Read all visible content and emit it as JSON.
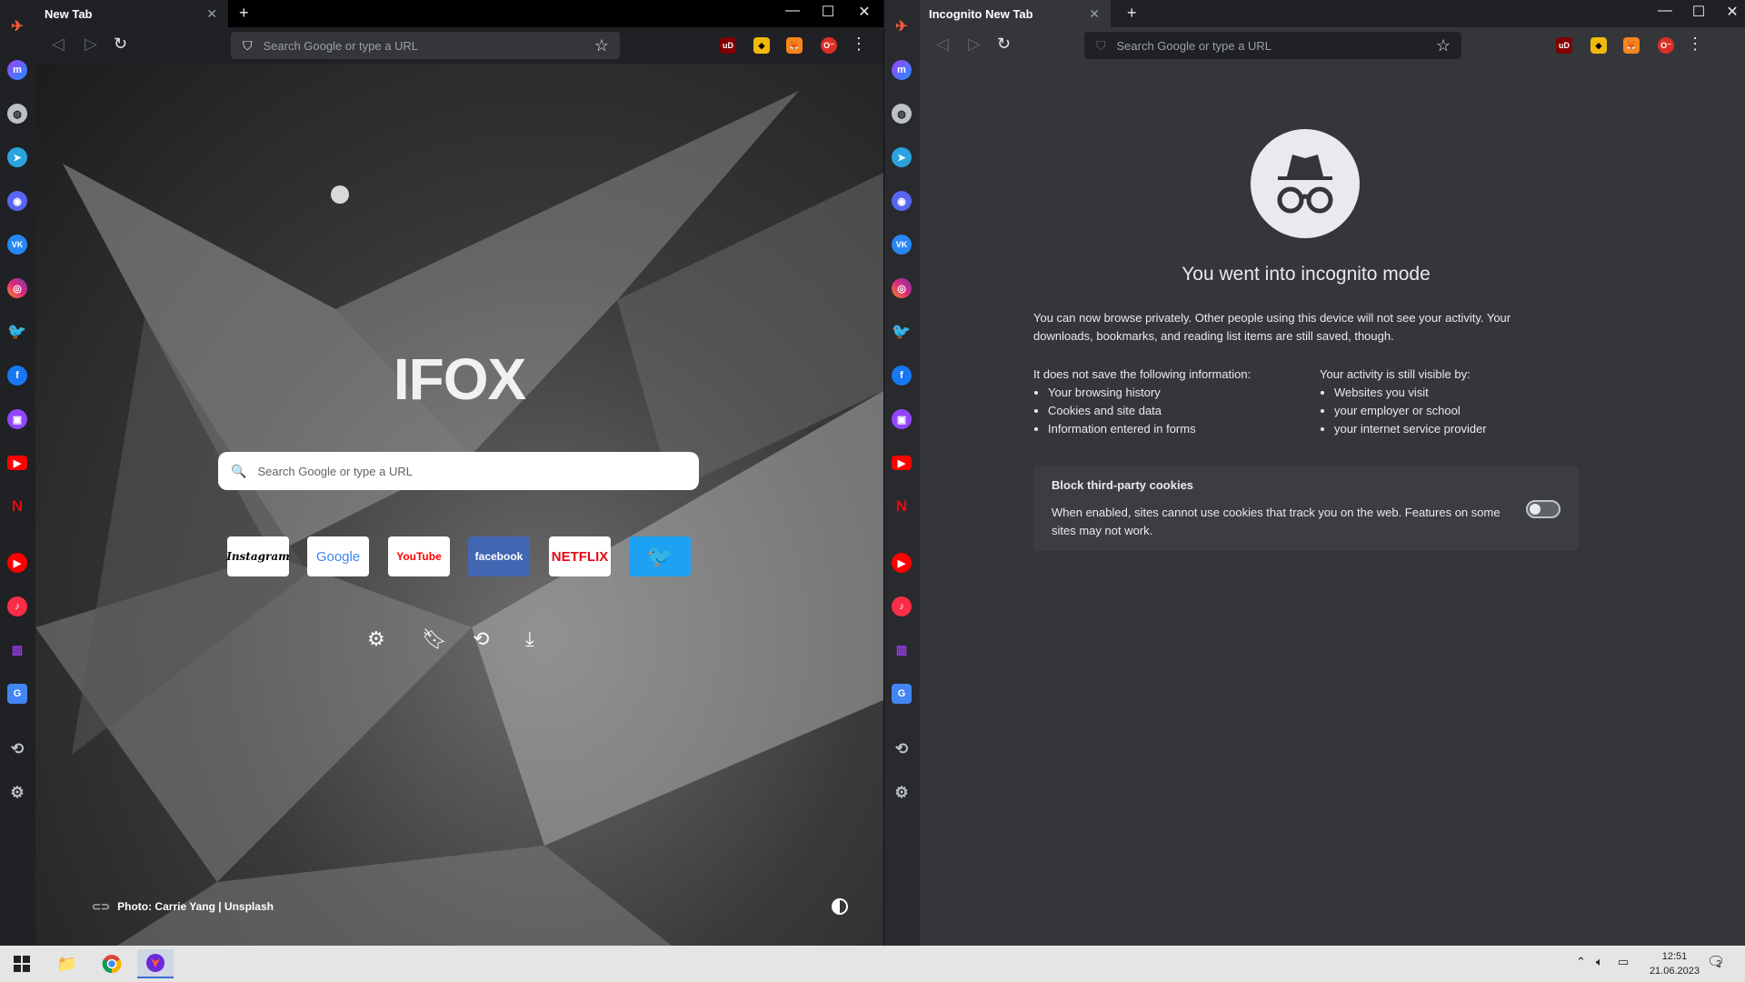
{
  "left_window": {
    "tab_title": "New Tab",
    "address_placeholder": "Search Google or type a URL",
    "logo_text": "IFOX",
    "search_placeholder": "Search Google or type a URL",
    "shortcuts": [
      {
        "label": "Instagram",
        "bg": "#ffffff",
        "fg": "#000000"
      },
      {
        "label": "Google",
        "bg": "#ffffff",
        "fg": "#4285f4"
      },
      {
        "label": "YouTube",
        "bg": "#ffffff",
        "fg": "#ff0000"
      },
      {
        "label": "facebook",
        "bg": "#4267b2",
        "fg": "#ffffff"
      },
      {
        "label": "NETFLIX",
        "bg": "#ffffff",
        "fg": "#e50914"
      },
      {
        "label": "twitter",
        "bg": "#1da1f2",
        "fg": "#ffffff"
      }
    ],
    "photo_credit": "Photo: Carrie Yang | Unsplash"
  },
  "right_window": {
    "tab_title": "Incognito New Tab",
    "address_placeholder": "Search Google or type a URL",
    "title": "You went into incognito mode",
    "intro": "You can now browse privately. Other people using this device will not see your activity. Your downloads, bookmarks, and reading list items are still saved, though.",
    "not_saved_heading": "It does not save the following information:",
    "not_saved_items": [
      "Your browsing history",
      "Cookies and site data",
      "Information entered in forms"
    ],
    "visible_heading": "Your activity is still visible by:",
    "visible_items": [
      "Websites you visit",
      "your employer or school",
      "your internet service provider"
    ],
    "cookie_title": "Block third-party cookies",
    "cookie_desc": "When enabled, sites cannot use cookies that track you on the web. Features on some sites may not work.",
    "cookie_toggle_on": false
  },
  "sidebar_icons": [
    "app-logo",
    "messenger",
    "globe",
    "telegram",
    "discord",
    "vk",
    "instagram",
    "twitter",
    "facebook",
    "twitch",
    "youtube",
    "netflix",
    "youtube-music",
    "apple-music",
    "deezer",
    "translate",
    "history",
    "settings"
  ],
  "taskbar": {
    "time": "12:51",
    "date": "21.06.2023",
    "notification_count": "2"
  }
}
